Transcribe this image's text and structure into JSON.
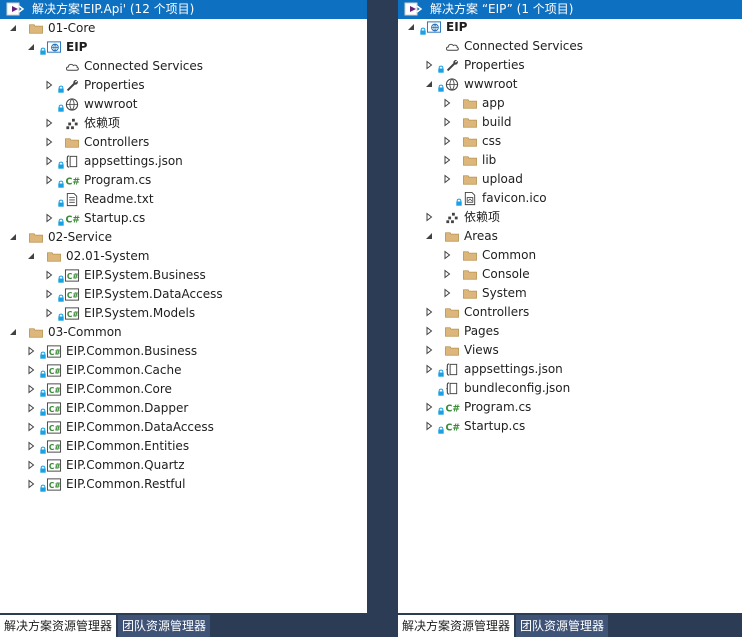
{
  "left": {
    "solution_title": "解决方案'EIP.Api' (12 个项目)",
    "rows": [
      {
        "label": "01-Core",
        "icon": "folder-icon",
        "expander": "expanded",
        "level": 0
      },
      {
        "label": "EIP",
        "icon": "web-project-icon",
        "expander": "expanded",
        "level": 1,
        "bold": true
      },
      {
        "label": "Connected Services",
        "icon": "cloud-icon",
        "expander": "none",
        "level": 2
      },
      {
        "label": "Properties",
        "icon": "wrench-icon",
        "expander": "collapsed",
        "level": 2
      },
      {
        "label": "wwwroot",
        "icon": "globe-icon",
        "expander": "none",
        "level": 2
      },
      {
        "label": "依赖项",
        "icon": "dependencies-icon",
        "expander": "collapsed",
        "level": 2
      },
      {
        "label": "Controllers",
        "icon": "folder-icon",
        "expander": "collapsed",
        "level": 2
      },
      {
        "label": "appsettings.json",
        "icon": "json-file-icon",
        "expander": "collapsed",
        "level": 2
      },
      {
        "label": "Program.cs",
        "icon": "csharp-icon",
        "expander": "collapsed",
        "level": 2
      },
      {
        "label": "Readme.txt",
        "icon": "text-file-icon",
        "expander": "none",
        "level": 2
      },
      {
        "label": "Startup.cs",
        "icon": "csharp-icon",
        "expander": "collapsed",
        "level": 2
      },
      {
        "label": "02-Service",
        "icon": "folder-icon",
        "expander": "expanded",
        "level": 0
      },
      {
        "label": "02.01-System",
        "icon": "folder-icon",
        "expander": "expanded",
        "level": 1
      },
      {
        "label": "EIP.System.Business",
        "icon": "csharp-project-icon",
        "expander": "collapsed",
        "level": 2
      },
      {
        "label": "EIP.System.DataAccess",
        "icon": "csharp-project-icon",
        "expander": "collapsed",
        "level": 2
      },
      {
        "label": "EIP.System.Models",
        "icon": "csharp-project-icon",
        "expander": "collapsed",
        "level": 2
      },
      {
        "label": "03-Common",
        "icon": "folder-icon",
        "expander": "expanded",
        "level": 0
      },
      {
        "label": "EIP.Common.Business",
        "icon": "csharp-project-icon",
        "expander": "collapsed",
        "level": 1
      },
      {
        "label": "EIP.Common.Cache",
        "icon": "csharp-project-icon",
        "expander": "collapsed",
        "level": 1
      },
      {
        "label": "EIP.Common.Core",
        "icon": "csharp-project-icon",
        "expander": "collapsed",
        "level": 1
      },
      {
        "label": "EIP.Common.Dapper",
        "icon": "csharp-project-icon",
        "expander": "collapsed",
        "level": 1
      },
      {
        "label": "EIP.Common.DataAccess",
        "icon": "csharp-project-icon",
        "expander": "collapsed",
        "level": 1
      },
      {
        "label": "EIP.Common.Entities",
        "icon": "csharp-project-icon",
        "expander": "collapsed",
        "level": 1
      },
      {
        "label": "EIP.Common.Quartz",
        "icon": "csharp-project-icon",
        "expander": "collapsed",
        "level": 1
      },
      {
        "label": "EIP.Common.Restful",
        "icon": "csharp-project-icon",
        "expander": "collapsed",
        "level": 1
      }
    ],
    "tabs": [
      {
        "label": "解决方案资源管理器",
        "active": true
      },
      {
        "label": "团队资源管理器",
        "active": false
      }
    ]
  },
  "right": {
    "solution_title": "解决方案 “EIP” (1 个项目)",
    "rows": [
      {
        "label": "EIP",
        "icon": "web-project-icon",
        "expander": "expanded",
        "level": 0,
        "bold": true
      },
      {
        "label": "Connected Services",
        "icon": "cloud-icon",
        "expander": "none",
        "level": 1
      },
      {
        "label": "Properties",
        "icon": "wrench-icon",
        "expander": "collapsed",
        "level": 1
      },
      {
        "label": "wwwroot",
        "icon": "globe-icon",
        "expander": "expanded",
        "level": 1
      },
      {
        "label": "app",
        "icon": "folder-icon",
        "expander": "collapsed",
        "level": 2
      },
      {
        "label": "build",
        "icon": "folder-icon",
        "expander": "collapsed",
        "level": 2
      },
      {
        "label": "css",
        "icon": "folder-icon",
        "expander": "collapsed",
        "level": 2
      },
      {
        "label": "lib",
        "icon": "folder-icon",
        "expander": "collapsed",
        "level": 2
      },
      {
        "label": "upload",
        "icon": "folder-icon",
        "expander": "collapsed",
        "level": 2
      },
      {
        "label": "favicon.ico",
        "icon": "ico-file-icon",
        "expander": "none",
        "level": 2
      },
      {
        "label": "依赖项",
        "icon": "dependencies-icon",
        "expander": "collapsed",
        "level": 1
      },
      {
        "label": "Areas",
        "icon": "folder-icon",
        "expander": "expanded",
        "level": 1
      },
      {
        "label": "Common",
        "icon": "folder-icon",
        "expander": "collapsed",
        "level": 2
      },
      {
        "label": "Console",
        "icon": "folder-icon",
        "expander": "collapsed",
        "level": 2
      },
      {
        "label": "System",
        "icon": "folder-icon",
        "expander": "collapsed",
        "level": 2
      },
      {
        "label": "Controllers",
        "icon": "folder-icon",
        "expander": "collapsed",
        "level": 1
      },
      {
        "label": "Pages",
        "icon": "folder-icon",
        "expander": "collapsed",
        "level": 1
      },
      {
        "label": "Views",
        "icon": "folder-icon",
        "expander": "collapsed",
        "level": 1
      },
      {
        "label": "appsettings.json",
        "icon": "json-file-icon",
        "expander": "collapsed",
        "level": 1
      },
      {
        "label": "bundleconfig.json",
        "icon": "json-file-icon",
        "expander": "none",
        "level": 1
      },
      {
        "label": "Program.cs",
        "icon": "csharp-icon",
        "expander": "collapsed",
        "level": 1
      },
      {
        "label": "Startup.cs",
        "icon": "csharp-icon",
        "expander": "collapsed",
        "level": 1
      }
    ],
    "tabs": [
      {
        "label": "解决方案资源管理器",
        "active": true
      },
      {
        "label": "团队资源管理器",
        "active": false
      }
    ]
  },
  "colors": {
    "selection": "#0e70c0",
    "folder": "#dcb67a",
    "csharp": "#388a34",
    "lock": "#1ba1e2",
    "frame": "#2d3c55",
    "inactive_tab": "#3f5377"
  }
}
